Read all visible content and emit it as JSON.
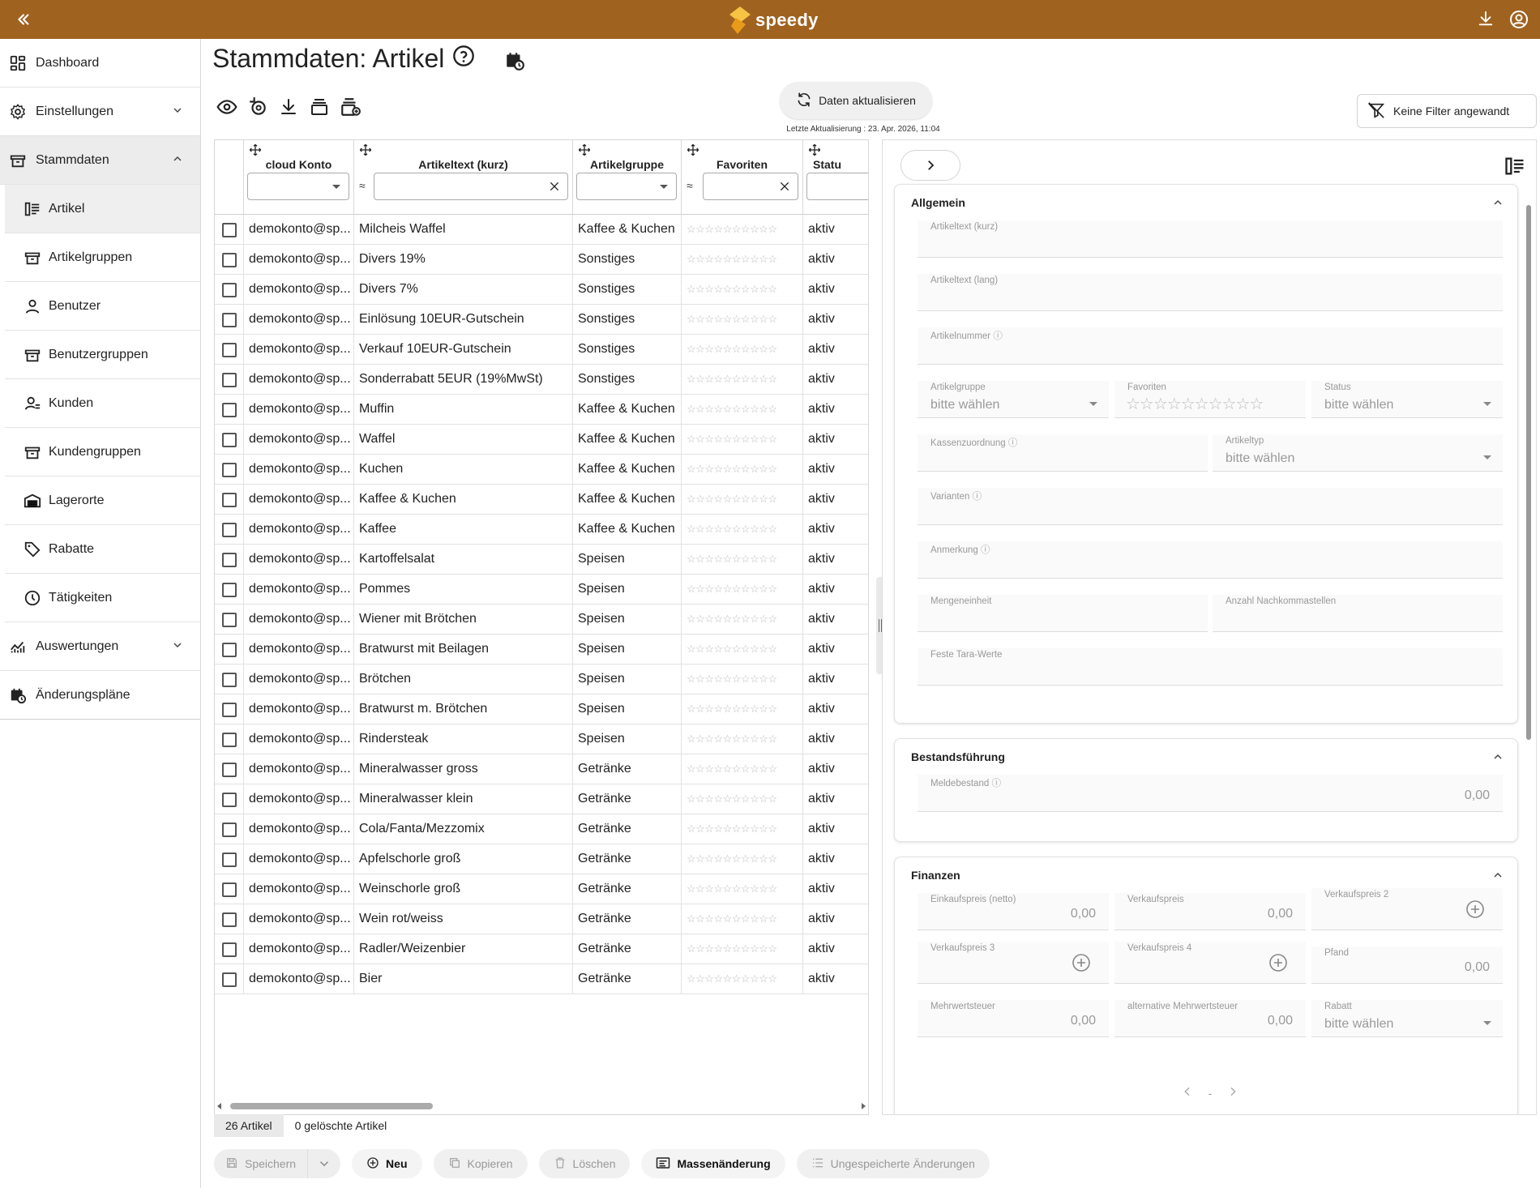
{
  "app": {
    "brand": "speedy",
    "colors": {
      "topbar": "#a0621f",
      "logo_top": "#f6c344",
      "logo_bottom": "#e89a1a"
    }
  },
  "sidebar": {
    "items": [
      {
        "label": "Dashboard",
        "icon": "dashboard-icon"
      },
      {
        "label": "Einstellungen",
        "icon": "gear-icon"
      },
      {
        "label": "Stammdaten",
        "icon": "box-icon"
      }
    ],
    "sub_items": [
      {
        "label": "Artikel",
        "icon": "article-list-icon",
        "active": true
      },
      {
        "label": "Artikelgruppen",
        "icon": "box-icon"
      },
      {
        "label": "Benutzer",
        "icon": "user-icon"
      },
      {
        "label": "Benutzergruppen",
        "icon": "box-icon"
      },
      {
        "label": "Kunden",
        "icon": "customer-icon"
      },
      {
        "label": "Kundengruppen",
        "icon": "box-icon"
      },
      {
        "label": "Lagerorte",
        "icon": "warehouse-icon"
      },
      {
        "label": "Rabatte",
        "icon": "tag-icon"
      },
      {
        "label": "Tätigkeiten",
        "icon": "clock-icon"
      }
    ],
    "bottom_items": [
      {
        "label": "Auswertungen",
        "icon": "chart-icon"
      },
      {
        "label": "Änderungspläne",
        "icon": "calendar-clock-icon"
      }
    ]
  },
  "main": {
    "title": "Stammdaten: Artikel",
    "refresh_label": "Daten aktualisieren",
    "last_update": "Letzte Aktualisierung : 23. Apr. 2026, 11:04",
    "filter_label": "Keine Filter angewandt"
  },
  "grid": {
    "columns": [
      "cloud Konto",
      "Artikeltext (kurz)",
      "Artikelgruppe",
      "Favoriten",
      "Statu"
    ],
    "filter_approx": "≈",
    "stars": "☆☆☆☆☆☆☆☆☆☆",
    "rows": [
      [
        "demokonto@sp...",
        "Milcheis Waffel",
        "Kaffee & Kuchen",
        "aktiv"
      ],
      [
        "demokonto@sp...",
        "Divers 19%",
        "Sonstiges",
        "aktiv"
      ],
      [
        "demokonto@sp...",
        "Divers 7%",
        "Sonstiges",
        "aktiv"
      ],
      [
        "demokonto@sp...",
        "Einlösung 10EUR-Gutschein",
        "Sonstiges",
        "aktiv"
      ],
      [
        "demokonto@sp...",
        "Verkauf 10EUR-Gutschein",
        "Sonstiges",
        "aktiv"
      ],
      [
        "demokonto@sp...",
        "Sonderrabatt 5EUR (19%MwSt)",
        "Sonstiges",
        "aktiv"
      ],
      [
        "demokonto@sp...",
        "Muffin",
        "Kaffee & Kuchen",
        "aktiv"
      ],
      [
        "demokonto@sp...",
        "Waffel",
        "Kaffee & Kuchen",
        "aktiv"
      ],
      [
        "demokonto@sp...",
        "Kuchen",
        "Kaffee & Kuchen",
        "aktiv"
      ],
      [
        "demokonto@sp...",
        "Kaffee & Kuchen",
        "Kaffee & Kuchen",
        "aktiv"
      ],
      [
        "demokonto@sp...",
        "Kaffee",
        "Kaffee & Kuchen",
        "aktiv"
      ],
      [
        "demokonto@sp...",
        "Kartoffelsalat",
        "Speisen",
        "aktiv"
      ],
      [
        "demokonto@sp...",
        "Pommes",
        "Speisen",
        "aktiv"
      ],
      [
        "demokonto@sp...",
        "Wiener mit Brötchen",
        "Speisen",
        "aktiv"
      ],
      [
        "demokonto@sp...",
        "Bratwurst mit Beilagen",
        "Speisen",
        "aktiv"
      ],
      [
        "demokonto@sp...",
        "Brötchen",
        "Speisen",
        "aktiv"
      ],
      [
        "demokonto@sp...",
        "Bratwurst m. Brötchen",
        "Speisen",
        "aktiv"
      ],
      [
        "demokonto@sp...",
        "Rindersteak",
        "Speisen",
        "aktiv"
      ],
      [
        "demokonto@sp...",
        "Mineralwasser gross",
        "Getränke",
        "aktiv"
      ],
      [
        "demokonto@sp...",
        "Mineralwasser klein",
        "Getränke",
        "aktiv"
      ],
      [
        "demokonto@sp...",
        "Cola/Fanta/Mezzomix",
        "Getränke",
        "aktiv"
      ],
      [
        "demokonto@sp...",
        "Apfelschorle groß",
        "Getränke",
        "aktiv"
      ],
      [
        "demokonto@sp...",
        "Weinschorle groß",
        "Getränke",
        "aktiv"
      ],
      [
        "demokonto@sp...",
        "Wein rot/weiss",
        "Getränke",
        "aktiv"
      ],
      [
        "demokonto@sp...",
        "Radler/Weizenbier",
        "Getränke",
        "aktiv"
      ],
      [
        "demokonto@sp...",
        "Bier",
        "Getränke",
        "aktiv"
      ]
    ],
    "footer_tabs": [
      "26 Artikel",
      "0 gelöschte Artikel"
    ]
  },
  "actions": {
    "save": "Speichern",
    "new": "Neu",
    "copy": "Kopieren",
    "delete": "Löschen",
    "mass_change": "Massenänderung",
    "unsaved": "Ungespeicherte Änderungen"
  },
  "detail": {
    "select_placeholder": "bitte wählen",
    "zero": "0,00",
    "pager_value": "-",
    "sections": {
      "allgemein": {
        "title": "Allgemein",
        "fields": {
          "artikeltext_kurz": "Artikeltext (kurz)",
          "artikeltext_lang": "Artikeltext (lang)",
          "artikelnummer": "Artikelnummer ⓘ",
          "artikelgruppe": "Artikelgruppe",
          "favoriten": "Favoriten",
          "status": "Status",
          "kassenzuordnung": "Kassenzuordnung ⓘ",
          "artikeltyp": "Artikeltyp",
          "varianten": "Varianten ⓘ",
          "anmerkung": "Anmerkung ⓘ",
          "mengeneinheit": "Mengeneinheit",
          "nachkommastellen": "Anzahl Nachkommastellen",
          "tara": "Feste Tara-Werte"
        }
      },
      "bestand": {
        "title": "Bestandsführung",
        "fields": {
          "meldebestand": "Meldebestand ⓘ"
        }
      },
      "finanzen": {
        "title": "Finanzen",
        "fields": {
          "einkaufspreis": "Einkaufspreis (netto)",
          "verkaufspreis": "Verkaufspreis",
          "verkaufspreis2": "Verkaufspreis 2",
          "verkaufspreis3": "Verkaufspreis 3",
          "verkaufspreis4": "Verkaufspreis 4",
          "pfand": "Pfand",
          "mwst": "Mehrwertsteuer",
          "alt_mwst": "alternative Mehrwertsteuer",
          "rabatt": "Rabatt"
        }
      }
    }
  }
}
